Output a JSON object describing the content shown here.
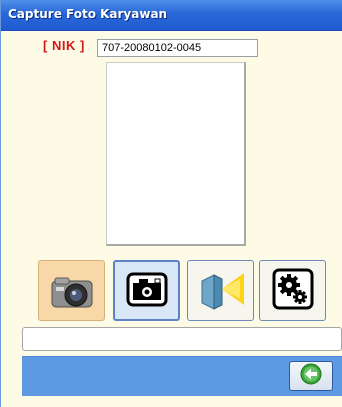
{
  "window": {
    "title": "Capture Foto Karyawan"
  },
  "form": {
    "nik_label": "[ NIK ]",
    "nik_value": "707-20080102-0045"
  },
  "toolbar": {
    "buttons": [
      {
        "icon": "digital-camera-icon"
      },
      {
        "icon": "capture-photo-icon"
      },
      {
        "icon": "flash-icon"
      },
      {
        "icon": "settings-gears-icon"
      }
    ]
  },
  "status": {
    "text": ""
  },
  "footer": {
    "back_icon": "back-arrow-icon"
  }
}
